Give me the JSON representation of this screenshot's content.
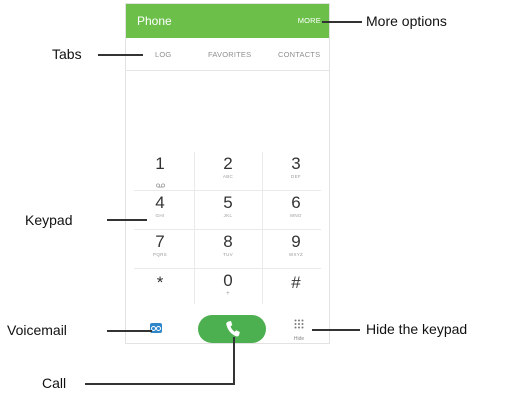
{
  "app": {
    "title": "Phone",
    "more": "MORE"
  },
  "tabs": [
    "LOG",
    "FAVORITES",
    "CONTACTS"
  ],
  "keypad": [
    {
      "digit": "1",
      "letters": ""
    },
    {
      "digit": "2",
      "letters": "ABC"
    },
    {
      "digit": "3",
      "letters": "DEF"
    },
    {
      "digit": "4",
      "letters": "GHI"
    },
    {
      "digit": "5",
      "letters": "JKL"
    },
    {
      "digit": "6",
      "letters": "MNO"
    },
    {
      "digit": "7",
      "letters": "PQRS"
    },
    {
      "digit": "8",
      "letters": "TUV"
    },
    {
      "digit": "9",
      "letters": "WXYZ"
    },
    {
      "digit": "*",
      "letters": ""
    },
    {
      "digit": "0",
      "letters": "+"
    },
    {
      "digit": "#",
      "letters": ""
    }
  ],
  "bottom": {
    "hide_label": "Hide"
  },
  "callouts": {
    "more_options": "More options",
    "tabs": "Tabs",
    "keypad": "Keypad",
    "voicemail": "Voicemail",
    "hide_keypad": "Hide the keypad",
    "call": "Call"
  },
  "colors": {
    "appbar": "#6cc04a",
    "call": "#4caf50",
    "voicemail": "#2f86c9"
  }
}
